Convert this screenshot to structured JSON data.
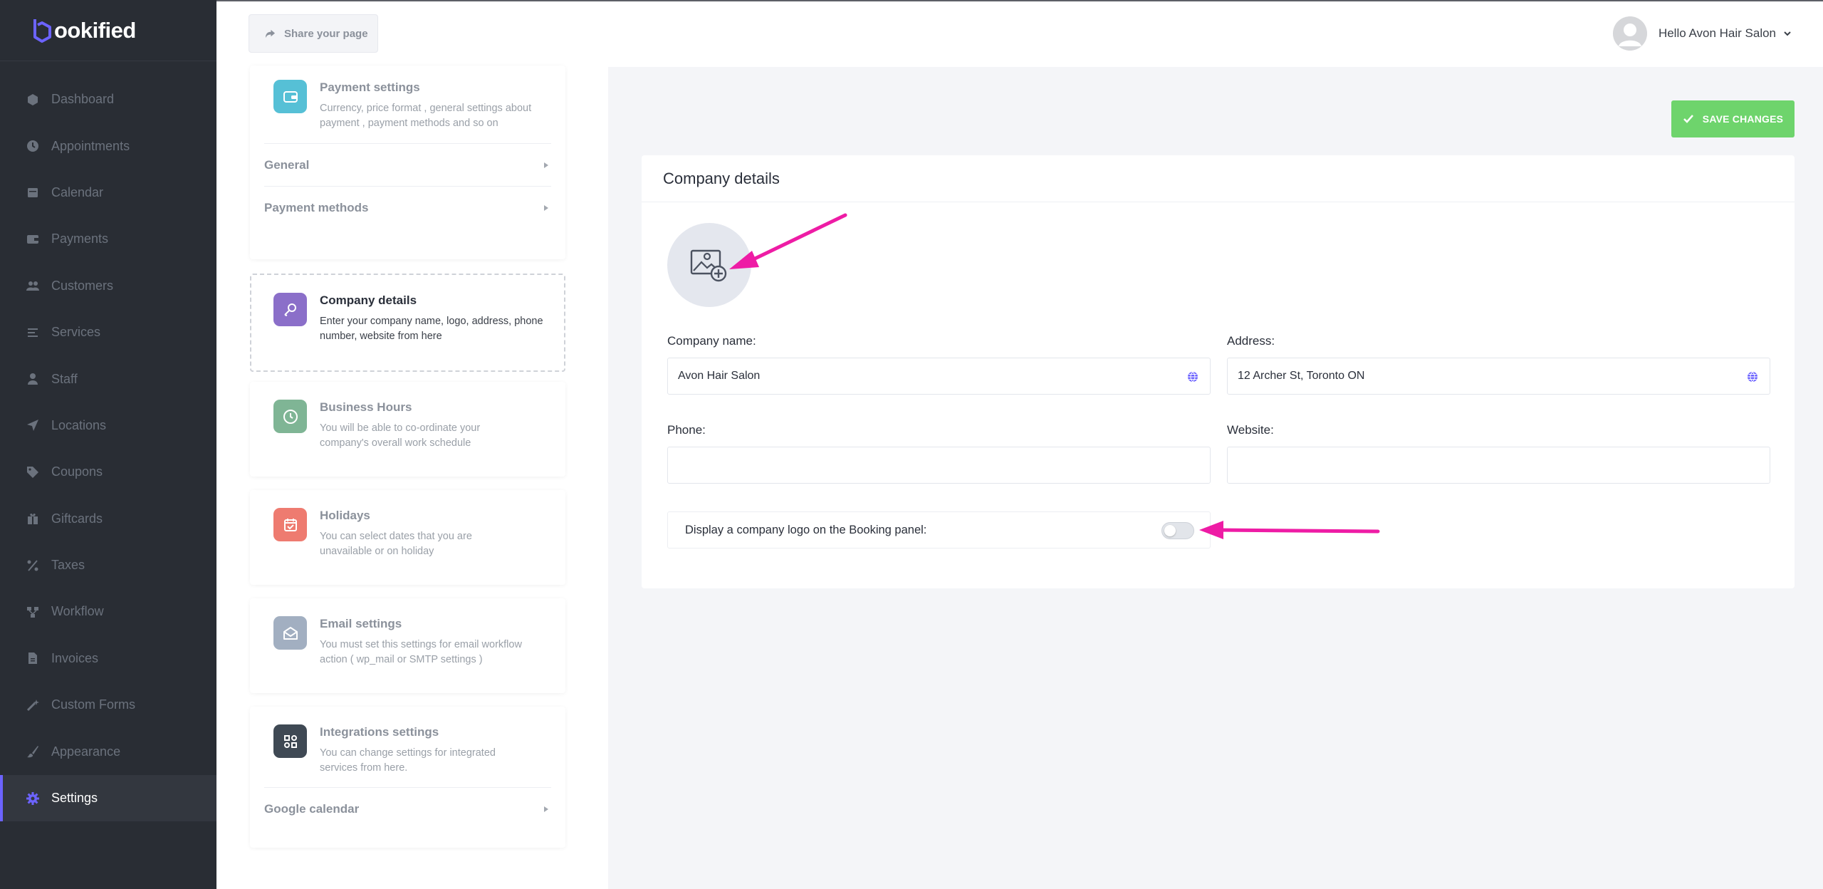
{
  "brand": {
    "name": "ookified",
    "mark": "b"
  },
  "sidebar": {
    "items": [
      {
        "label": "Dashboard",
        "icon": "cube-icon"
      },
      {
        "label": "Appointments",
        "icon": "clock-icon"
      },
      {
        "label": "Calendar",
        "icon": "calendar-icon"
      },
      {
        "label": "Payments",
        "icon": "wallet-icon"
      },
      {
        "label": "Customers",
        "icon": "users-icon"
      },
      {
        "label": "Services",
        "icon": "list-icon"
      },
      {
        "label": "Staff",
        "icon": "user-icon"
      },
      {
        "label": "Locations",
        "icon": "location-arrow-icon"
      },
      {
        "label": "Coupons",
        "icon": "tag-icon"
      },
      {
        "label": "Giftcards",
        "icon": "gift-icon"
      },
      {
        "label": "Taxes",
        "icon": "percent-icon"
      },
      {
        "label": "Workflow",
        "icon": "workflow-icon"
      },
      {
        "label": "Invoices",
        "icon": "file-icon"
      },
      {
        "label": "Custom Forms",
        "icon": "magic-wand-icon"
      },
      {
        "label": "Appearance",
        "icon": "brush-icon"
      },
      {
        "label": "Settings",
        "icon": "gear-icon",
        "active": true
      }
    ]
  },
  "header": {
    "share_label": "Share your page",
    "greeting": "Hello Avon Hair Salon"
  },
  "settings": {
    "payment": {
      "title": "Payment settings",
      "desc": "Currency, price format , general settings about payment , payment methods and so on",
      "sub": [
        "General",
        "Payment methods"
      ]
    },
    "company": {
      "title": "Company details",
      "desc": "Enter your company name, logo, address, phone number, website from here"
    },
    "hours": {
      "title": "Business Hours",
      "desc": "You will be able to co-ordinate your company's overall work schedule"
    },
    "holidays": {
      "title": "Holidays",
      "desc": "You can select dates that you are unavailable or on holiday"
    },
    "email": {
      "title": "Email settings",
      "desc": "You must set this settings for email workflow action ( wp_mail or SMTP settings )"
    },
    "integrations": {
      "title": "Integrations settings",
      "desc": "You can change settings for integrated services from here.",
      "sub": [
        "Google calendar"
      ]
    }
  },
  "main": {
    "save_label": "SAVE CHANGES",
    "panel_title": "Company details",
    "company_name": {
      "label": "Company name:",
      "value": "Avon Hair Salon"
    },
    "address": {
      "label": "Address:",
      "value": "12 Archer St, Toronto ON"
    },
    "phone": {
      "label": "Phone:",
      "value": ""
    },
    "website": {
      "label": "Website:",
      "value": ""
    },
    "display_logo": {
      "label": "Display a company logo on the Booking panel:",
      "enabled": false
    }
  },
  "colors": {
    "sidebar_bg": "#292d34",
    "accent": "#6c63ff",
    "save": "#6ed46c",
    "annotation_arrow": "#ee1ca5"
  }
}
